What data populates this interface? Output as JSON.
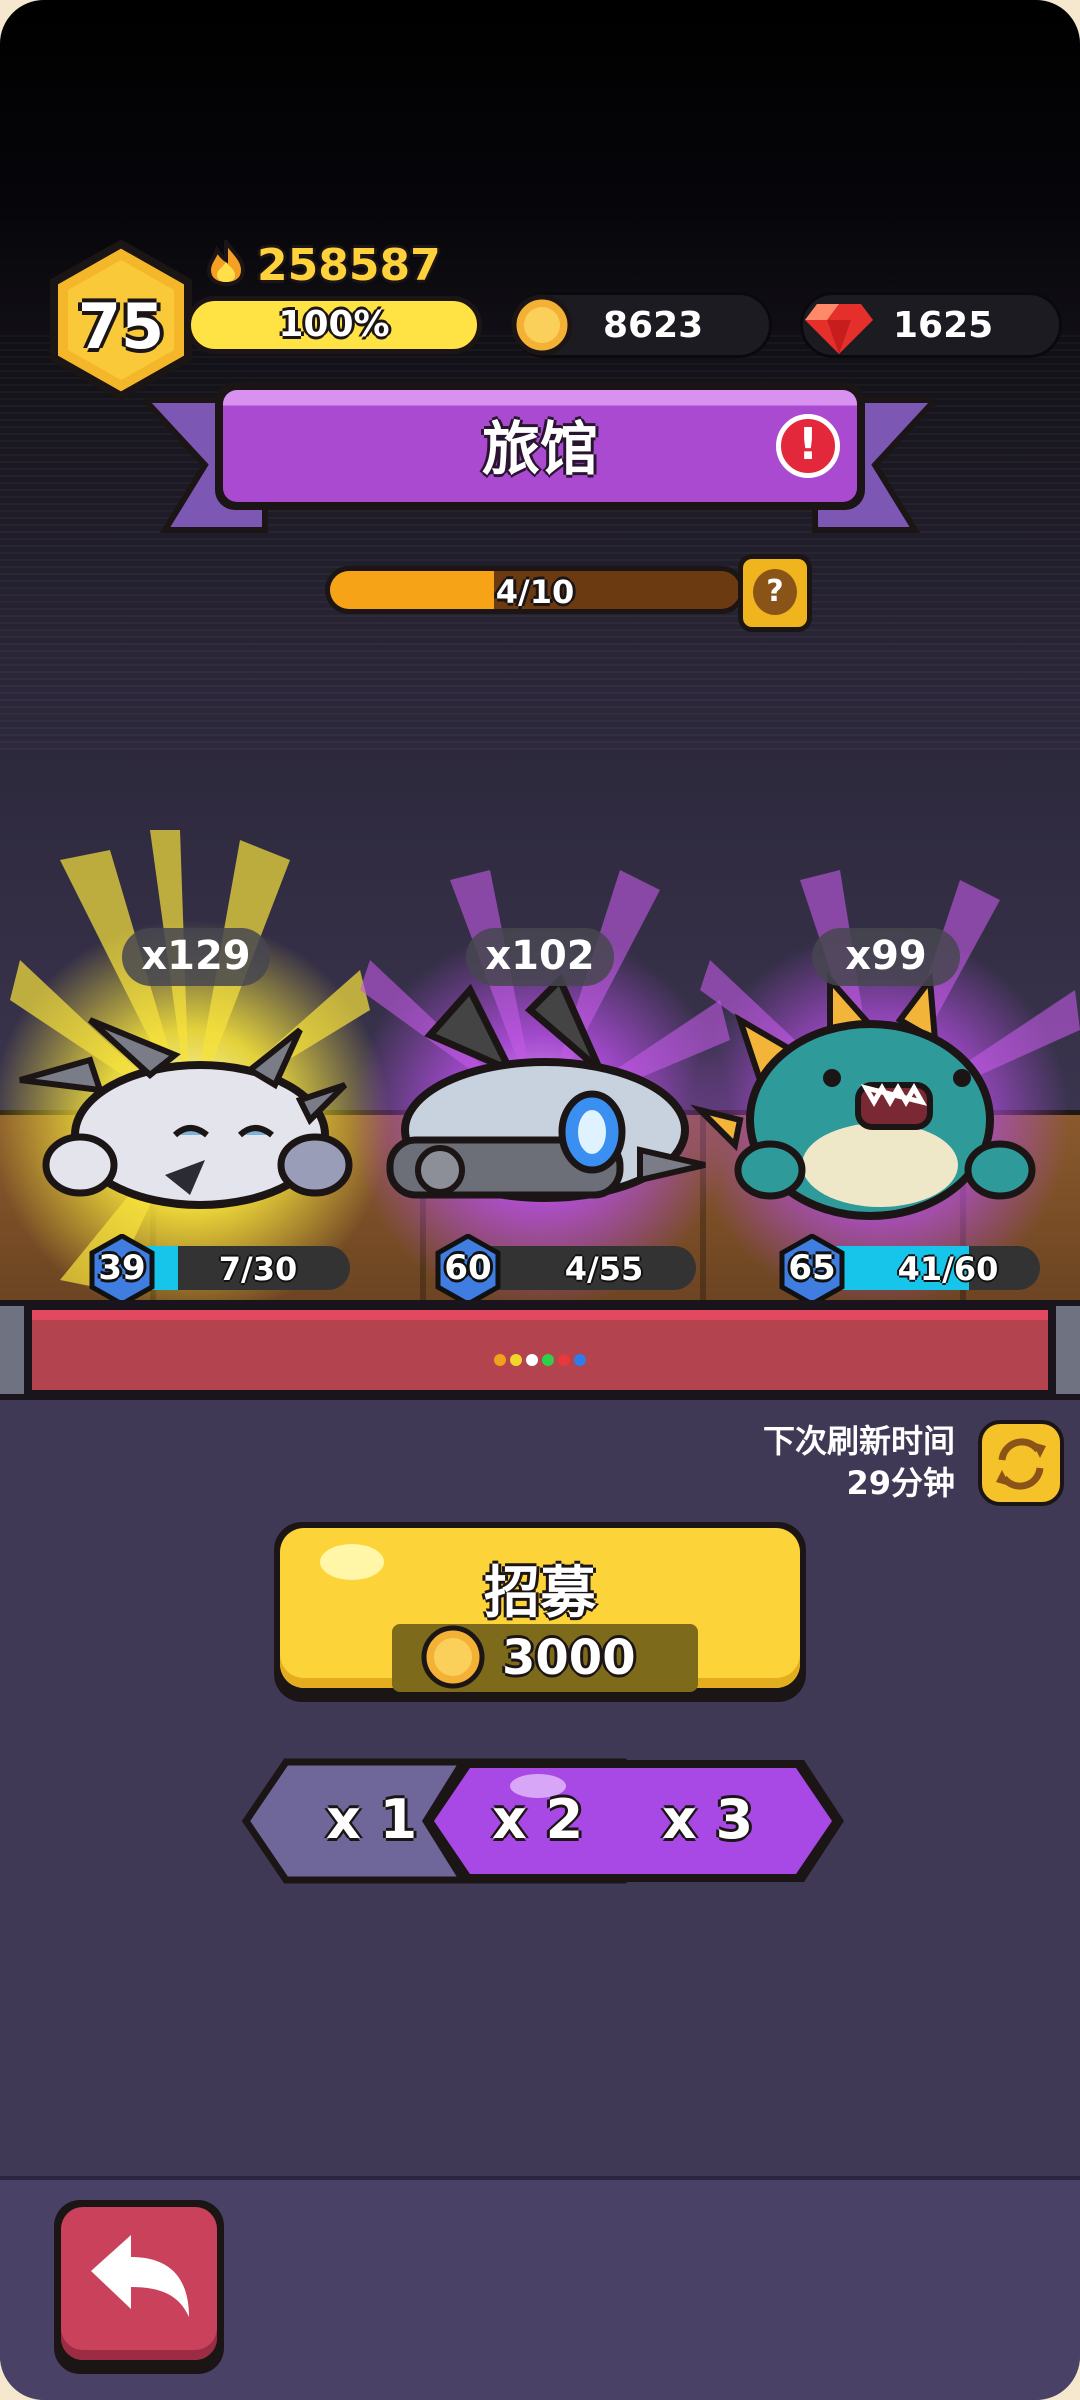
{
  "header": {
    "player_level": "75",
    "power": "258587",
    "xp_percent_label": "100%",
    "xp_fraction": 1.0,
    "gold": "8623",
    "gems": "1625"
  },
  "title": {
    "text": "旅馆"
  },
  "inn_progress": {
    "label": "4/10",
    "current": 4,
    "max": 10
  },
  "heroes": [
    {
      "count": "x129",
      "level": "39",
      "progress": "7/30",
      "fraction": 0.233,
      "rarity_color": "#f5df2a"
    },
    {
      "count": "x102",
      "level": "60",
      "progress": "4/55",
      "fraction": 0.073,
      "rarity_color": "#b34de0"
    },
    {
      "count": "x99",
      "level": "65",
      "progress": "41/60",
      "fraction": 0.683,
      "rarity_color": "#b34de0"
    }
  ],
  "refresh": {
    "label_line1": "下次刷新时间",
    "label_line2": "29分钟"
  },
  "recruit": {
    "label": "招募",
    "cost": "3000"
  },
  "multipliers": {
    "options": [
      "x 1",
      "x 2",
      "x 3"
    ],
    "selected": "x 3"
  },
  "colors": {
    "gold_accent": "#fcd43a",
    "purple_accent": "#a94ad1",
    "back_button": "#c9415b"
  },
  "icons": [
    "flame-icon",
    "coin-icon",
    "gem-icon",
    "alert-icon",
    "help-icon",
    "refresh-icon",
    "back-arrow-icon"
  ]
}
